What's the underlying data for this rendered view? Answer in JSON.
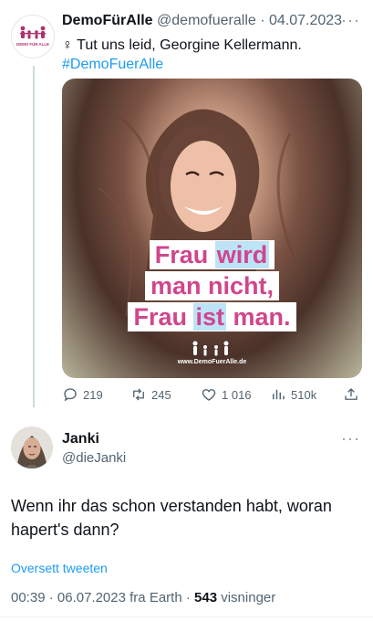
{
  "tweet": {
    "author_name": "DemoFürAlle",
    "author_handle": "@demofueralle",
    "date": "04.07.2023",
    "text_symbol": "♀",
    "text": "Tut uns leid, Georgine Kellermann.",
    "hashtag": "#DemoFuerAlle",
    "avatar_label": "DEMO FÜR ALLE",
    "media": {
      "line1_a": "Frau",
      "line1_b": "wird",
      "line2": "man nicht,",
      "line3_a": "Frau",
      "line3_b": "ist",
      "line3_c": "man.",
      "url": "www.DemoFuerAlle.de"
    },
    "actions": {
      "replies": "219",
      "retweets": "245",
      "likes": "1 016",
      "views": "510k"
    }
  },
  "reply": {
    "author_name": "Janki",
    "author_handle": "@dieJanki",
    "text": "Wenn ihr das schon verstanden habt, woran hapert's dann?",
    "translate_label": "Oversett tweeten",
    "time": "00:39",
    "date": "06.07.2023",
    "source": "fra Earth",
    "views_count": "543",
    "views_label": "visninger"
  },
  "more_label": "···",
  "colors": {
    "brand_pink": "#d0468c",
    "link_blue": "#1d9bf0",
    "muted": "#536471"
  }
}
